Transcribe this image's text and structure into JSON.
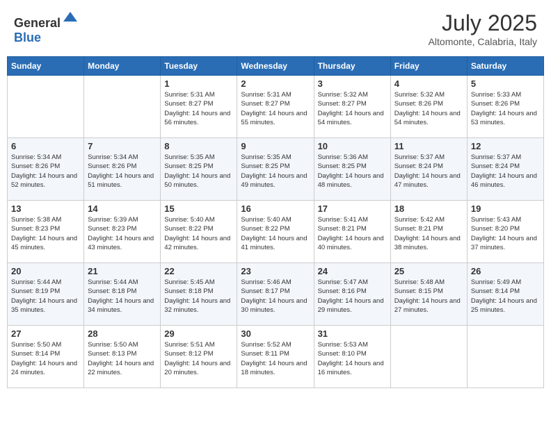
{
  "header": {
    "logo_general": "General",
    "logo_blue": "Blue",
    "month": "July 2025",
    "location": "Altomonte, Calabria, Italy"
  },
  "days_of_week": [
    "Sunday",
    "Monday",
    "Tuesday",
    "Wednesday",
    "Thursday",
    "Friday",
    "Saturday"
  ],
  "weeks": [
    [
      {
        "day": "",
        "info": ""
      },
      {
        "day": "",
        "info": ""
      },
      {
        "day": "1",
        "sunrise": "5:31 AM",
        "sunset": "8:27 PM",
        "daylight": "14 hours and 56 minutes."
      },
      {
        "day": "2",
        "sunrise": "5:31 AM",
        "sunset": "8:27 PM",
        "daylight": "14 hours and 55 minutes."
      },
      {
        "day": "3",
        "sunrise": "5:32 AM",
        "sunset": "8:27 PM",
        "daylight": "14 hours and 54 minutes."
      },
      {
        "day": "4",
        "sunrise": "5:32 AM",
        "sunset": "8:26 PM",
        "daylight": "14 hours and 54 minutes."
      },
      {
        "day": "5",
        "sunrise": "5:33 AM",
        "sunset": "8:26 PM",
        "daylight": "14 hours and 53 minutes."
      }
    ],
    [
      {
        "day": "6",
        "sunrise": "5:34 AM",
        "sunset": "8:26 PM",
        "daylight": "14 hours and 52 minutes."
      },
      {
        "day": "7",
        "sunrise": "5:34 AM",
        "sunset": "8:26 PM",
        "daylight": "14 hours and 51 minutes."
      },
      {
        "day": "8",
        "sunrise": "5:35 AM",
        "sunset": "8:25 PM",
        "daylight": "14 hours and 50 minutes."
      },
      {
        "day": "9",
        "sunrise": "5:35 AM",
        "sunset": "8:25 PM",
        "daylight": "14 hours and 49 minutes."
      },
      {
        "day": "10",
        "sunrise": "5:36 AM",
        "sunset": "8:25 PM",
        "daylight": "14 hours and 48 minutes."
      },
      {
        "day": "11",
        "sunrise": "5:37 AM",
        "sunset": "8:24 PM",
        "daylight": "14 hours and 47 minutes."
      },
      {
        "day": "12",
        "sunrise": "5:37 AM",
        "sunset": "8:24 PM",
        "daylight": "14 hours and 46 minutes."
      }
    ],
    [
      {
        "day": "13",
        "sunrise": "5:38 AM",
        "sunset": "8:23 PM",
        "daylight": "14 hours and 45 minutes."
      },
      {
        "day": "14",
        "sunrise": "5:39 AM",
        "sunset": "8:23 PM",
        "daylight": "14 hours and 43 minutes."
      },
      {
        "day": "15",
        "sunrise": "5:40 AM",
        "sunset": "8:22 PM",
        "daylight": "14 hours and 42 minutes."
      },
      {
        "day": "16",
        "sunrise": "5:40 AM",
        "sunset": "8:22 PM",
        "daylight": "14 hours and 41 minutes."
      },
      {
        "day": "17",
        "sunrise": "5:41 AM",
        "sunset": "8:21 PM",
        "daylight": "14 hours and 40 minutes."
      },
      {
        "day": "18",
        "sunrise": "5:42 AM",
        "sunset": "8:21 PM",
        "daylight": "14 hours and 38 minutes."
      },
      {
        "day": "19",
        "sunrise": "5:43 AM",
        "sunset": "8:20 PM",
        "daylight": "14 hours and 37 minutes."
      }
    ],
    [
      {
        "day": "20",
        "sunrise": "5:44 AM",
        "sunset": "8:19 PM",
        "daylight": "14 hours and 35 minutes."
      },
      {
        "day": "21",
        "sunrise": "5:44 AM",
        "sunset": "8:18 PM",
        "daylight": "14 hours and 34 minutes."
      },
      {
        "day": "22",
        "sunrise": "5:45 AM",
        "sunset": "8:18 PM",
        "daylight": "14 hours and 32 minutes."
      },
      {
        "day": "23",
        "sunrise": "5:46 AM",
        "sunset": "8:17 PM",
        "daylight": "14 hours and 30 minutes."
      },
      {
        "day": "24",
        "sunrise": "5:47 AM",
        "sunset": "8:16 PM",
        "daylight": "14 hours and 29 minutes."
      },
      {
        "day": "25",
        "sunrise": "5:48 AM",
        "sunset": "8:15 PM",
        "daylight": "14 hours and 27 minutes."
      },
      {
        "day": "26",
        "sunrise": "5:49 AM",
        "sunset": "8:14 PM",
        "daylight": "14 hours and 25 minutes."
      }
    ],
    [
      {
        "day": "27",
        "sunrise": "5:50 AM",
        "sunset": "8:14 PM",
        "daylight": "14 hours and 24 minutes."
      },
      {
        "day": "28",
        "sunrise": "5:50 AM",
        "sunset": "8:13 PM",
        "daylight": "14 hours and 22 minutes."
      },
      {
        "day": "29",
        "sunrise": "5:51 AM",
        "sunset": "8:12 PM",
        "daylight": "14 hours and 20 minutes."
      },
      {
        "day": "30",
        "sunrise": "5:52 AM",
        "sunset": "8:11 PM",
        "daylight": "14 hours and 18 minutes."
      },
      {
        "day": "31",
        "sunrise": "5:53 AM",
        "sunset": "8:10 PM",
        "daylight": "14 hours and 16 minutes."
      },
      {
        "day": "",
        "info": ""
      },
      {
        "day": "",
        "info": ""
      }
    ]
  ],
  "labels": {
    "sunrise": "Sunrise:",
    "sunset": "Sunset:",
    "daylight": "Daylight:"
  }
}
